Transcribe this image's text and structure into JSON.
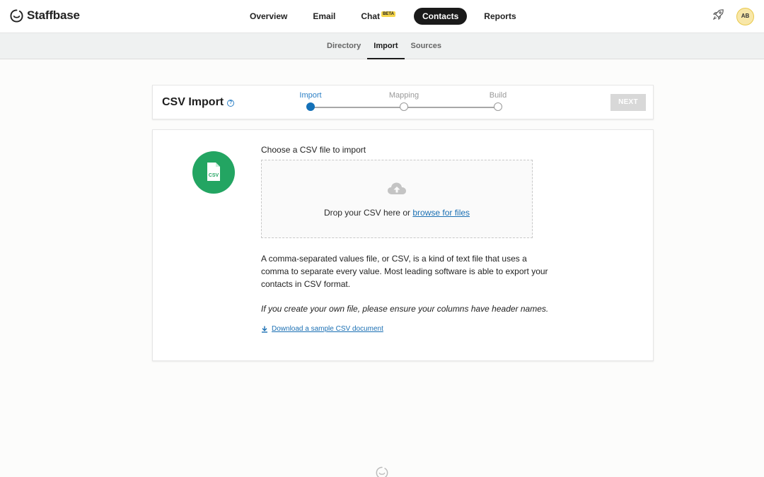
{
  "brand": {
    "name": "Staffbase"
  },
  "nav": {
    "items": [
      {
        "label": "Overview"
      },
      {
        "label": "Email"
      },
      {
        "label": "Chat",
        "badge": "BETA"
      },
      {
        "label": "Contacts",
        "active": true
      },
      {
        "label": "Reports"
      }
    ]
  },
  "user": {
    "initials": "AB"
  },
  "subnav": {
    "items": [
      {
        "label": "Directory"
      },
      {
        "label": "Import",
        "active": true
      },
      {
        "label": "Sources"
      }
    ]
  },
  "import_header": {
    "title": "CSV Import",
    "help_glyph": "?",
    "steps": [
      {
        "label": "Import",
        "active": true
      },
      {
        "label": "Mapping"
      },
      {
        "label": "Build"
      }
    ],
    "next_label": "NEXT"
  },
  "upload": {
    "file_icon_label": "CSV",
    "choose_label": "Choose a CSV file to import",
    "drop_text": "Drop your CSV here or",
    "browse_link": "browse for files",
    "description": "A comma-separated values file, or CSV, is a kind of text file that uses a comma to separate every value. Most leading software is able to export your contacts in CSV format.",
    "hint": "If you create your own file, please ensure your columns have header names.",
    "download_link": "Download a sample CSV document"
  },
  "icons": {
    "logo": "staffbase-logo-icon",
    "rocket": "rocket-icon",
    "help": "help-icon",
    "csv_file": "csv-file-icon",
    "cloud_upload": "cloud-upload-icon",
    "download": "download-icon"
  },
  "colors": {
    "accent": "#1471b8",
    "link": "#1a6fb3",
    "csv_green": "#23a562",
    "beta_badge": "#f6d64a",
    "active_nav": "#1a1a1a"
  }
}
